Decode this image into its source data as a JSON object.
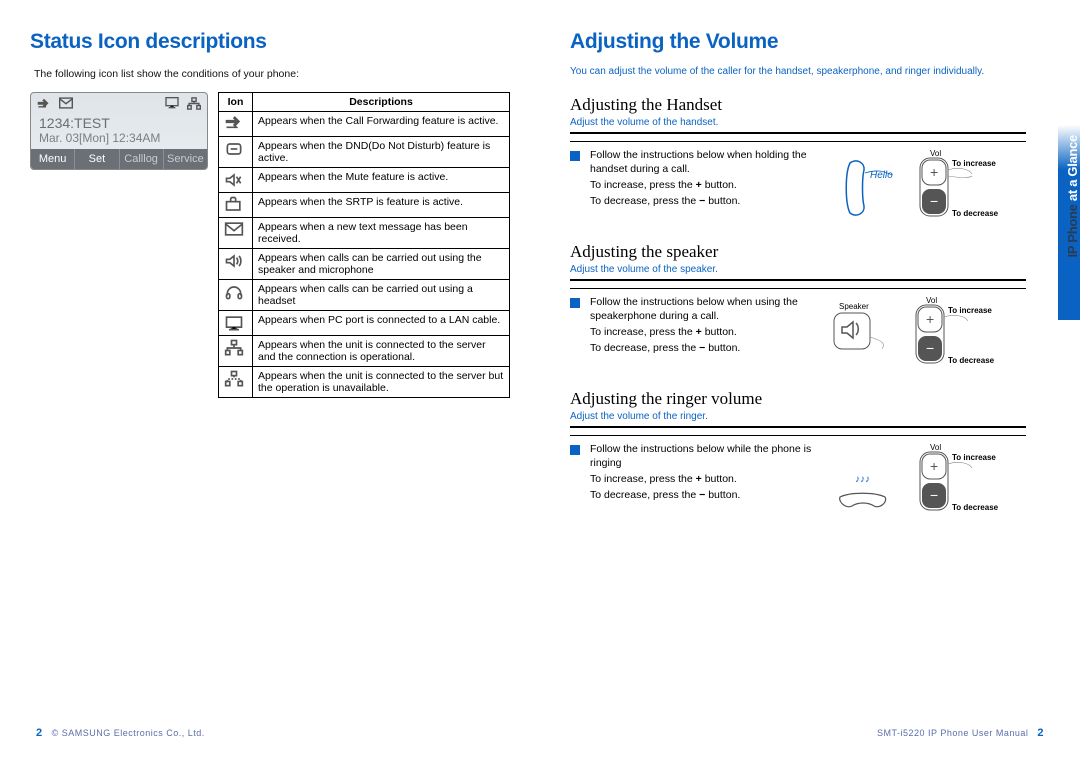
{
  "left": {
    "title": "Status Icon descriptions",
    "intro": "The following icon list show the conditions of your phone:",
    "lcd": {
      "line1": "1234:TEST",
      "line2": "Mar. 03[Mon] 12:34AM",
      "softkeys": [
        "Menu",
        "Set",
        "Calllog",
        "Service"
      ]
    },
    "table_headers": [
      "Ion",
      "Descriptions"
    ],
    "rows": [
      {
        "desc": "Appears when the Call Forwarding feature is active."
      },
      {
        "desc": "Appears when the DND(Do Not Disturb) feature is active."
      },
      {
        "desc": "Appears when the Mute feature is active."
      },
      {
        "desc": "Appears when the SRTP is feature is active."
      },
      {
        "desc": "Appears when a new text message has been received."
      },
      {
        "desc": "Appears when calls can be carried out using the speaker and microphone"
      },
      {
        "desc": "Appears when calls can be carried out using a headset"
      },
      {
        "desc": "Appears when PC port is connected to a LAN cable."
      },
      {
        "desc": "Appears when the unit is connected to the server and the connection is operational."
      },
      {
        "desc": "Appears when the unit is connected to the server but the operation is unavailable."
      }
    ],
    "footer_pg": "2",
    "footer_text": "© SAMSUNG Electronics Co., Ltd."
  },
  "right": {
    "title": "Adjusting the Volume",
    "intro": "You can adjust the volume of the caller for the handset, speakerphone, and ringer individually.",
    "side_tab": "IP Phone at a Glance",
    "sections": [
      {
        "h": "Adjusting the Handset",
        "note": "Adjust the volume of the handset.",
        "line1": "Follow the instructions below when holding the handset during a call.",
        "inc": "To increase, press the + button.",
        "dec": "To decrease, press the − button.",
        "hello": "Hello",
        "vol": "Vol",
        "inc_lbl": "To increase",
        "dec_lbl": "To decrease"
      },
      {
        "h": "Adjusting the speaker",
        "note": "Adjust the volume of the speaker.",
        "line1": "Follow the instructions below when using the speakerphone during a call.",
        "inc": "To increase, press the + button.",
        "dec": "To decrease, press the − button.",
        "spk": "Speaker",
        "vol": "Vol",
        "inc_lbl": "To increase",
        "dec_lbl": "To decrease"
      },
      {
        "h": "Adjusting the ringer volume",
        "note": "Adjust the volume of the ringer.",
        "line1": "Follow the instructions below while the phone is ringing",
        "inc": "To increase, press the + button.",
        "dec": "To decrease, press the − button.",
        "vol": "Vol",
        "inc_lbl": "To increase",
        "dec_lbl": "To decrease"
      }
    ],
    "footer_text": "SMT-i5220 IP Phone User Manual",
    "footer_pg": "2"
  }
}
